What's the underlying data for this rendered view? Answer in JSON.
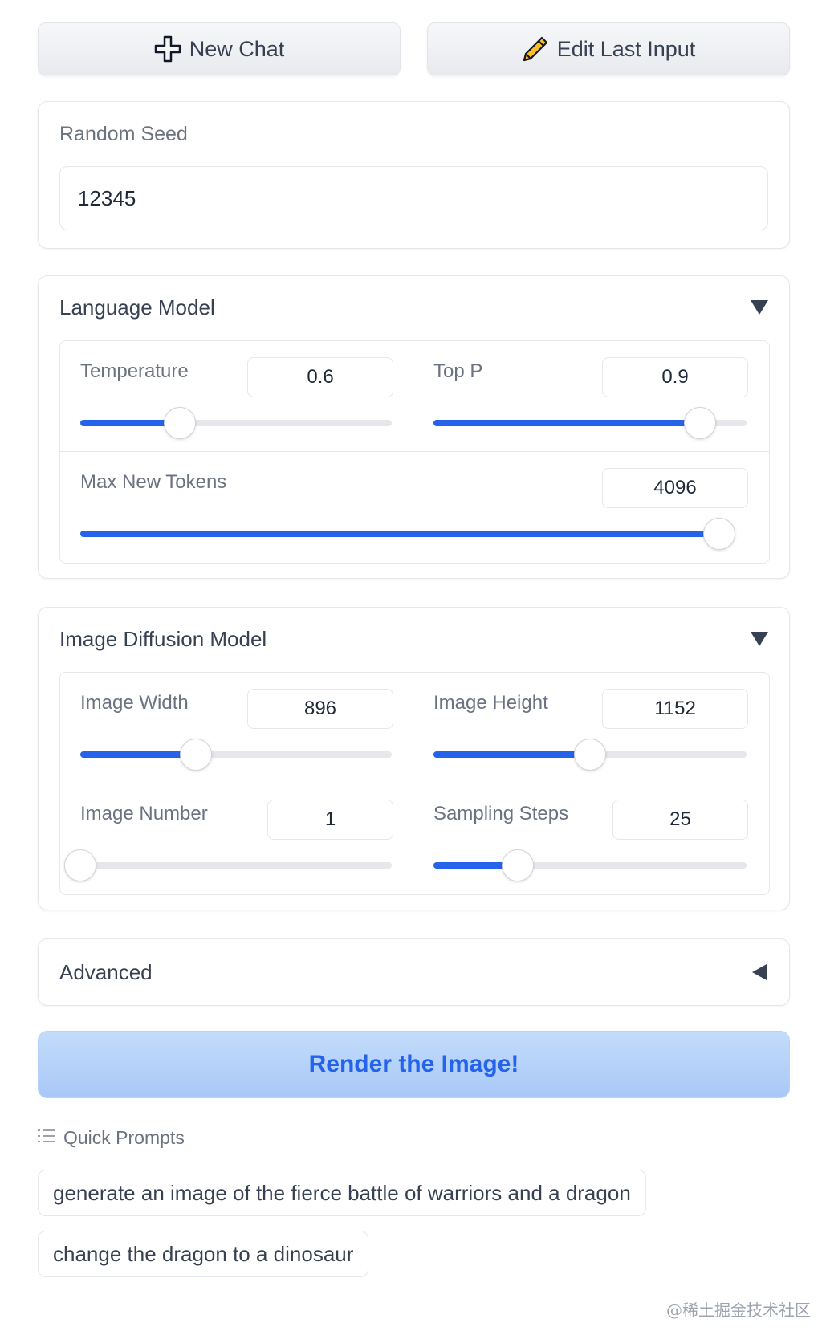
{
  "toolbar": {
    "new_chat_label": "New Chat",
    "edit_last_input_label": "Edit Last Input"
  },
  "seed": {
    "label": "Random Seed",
    "value": "12345"
  },
  "language_model": {
    "title": "Language Model",
    "temperature": {
      "label": "Temperature",
      "value": "0.6",
      "fraction": 0.32
    },
    "top_p": {
      "label": "Top P",
      "value": "0.9",
      "fraction": 0.85
    },
    "max_new_tokens": {
      "label": "Max New Tokens",
      "value": "4096",
      "fraction": 0.98
    }
  },
  "image_model": {
    "title": "Image Diffusion Model",
    "width": {
      "label": "Image Width",
      "value": "896",
      "fraction": 0.37
    },
    "height": {
      "label": "Image Height",
      "value": "1152",
      "fraction": 0.5
    },
    "number": {
      "label": "Image Number",
      "value": "1",
      "fraction": 0.0
    },
    "steps": {
      "label": "Sampling Steps",
      "value": "25",
      "fraction": 0.27
    }
  },
  "advanced": {
    "title": "Advanced"
  },
  "render_button_label": "Render the Image!",
  "quick_prompts": {
    "header": "Quick Prompts",
    "items": [
      "generate an image of the fierce battle of warriors and a dragon",
      "change the dragon to a dinosaur"
    ]
  },
  "watermark": "@稀土掘金技术社区",
  "colors": {
    "accent": "#2563eb",
    "render_button_bg": "#b7d2f9"
  }
}
